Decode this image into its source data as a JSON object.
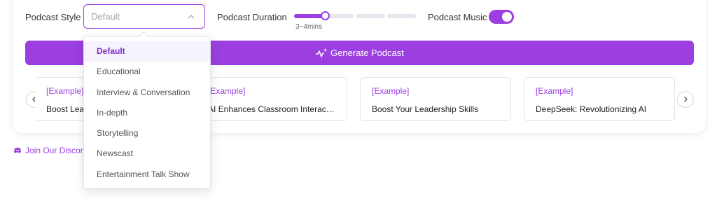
{
  "controls": {
    "style_label": "Podcast Style",
    "style_placeholder": "Default",
    "duration_label": "Podcast Duration",
    "duration_value": "3~4mins",
    "duration_step": 1,
    "duration_steps_total": 4,
    "music_label": "Podcast Music",
    "music_on": true
  },
  "generate_label": "Generate Podcast",
  "examples": [
    {
      "tag": "[Example]",
      "title": "Boost Leadership Skills"
    },
    {
      "tag": "[Example]",
      "title": "AI Enhances Classroom Interactions"
    },
    {
      "tag": "[Example]",
      "title": "Boost Your Leadership Skills"
    },
    {
      "tag": "[Example]",
      "title": "DeepSeek: Revolutionizing AI"
    }
  ],
  "discord_label": "Join Our Discord",
  "dropdown": {
    "options": [
      "Default",
      "Educational",
      "Interview & Conversation",
      "In-depth",
      "Storytelling",
      "Newscast",
      "Entertainment Talk Show"
    ],
    "selected_index": 0
  },
  "colors": {
    "accent": "#9b3fe0",
    "border": "#e3e3e8"
  }
}
